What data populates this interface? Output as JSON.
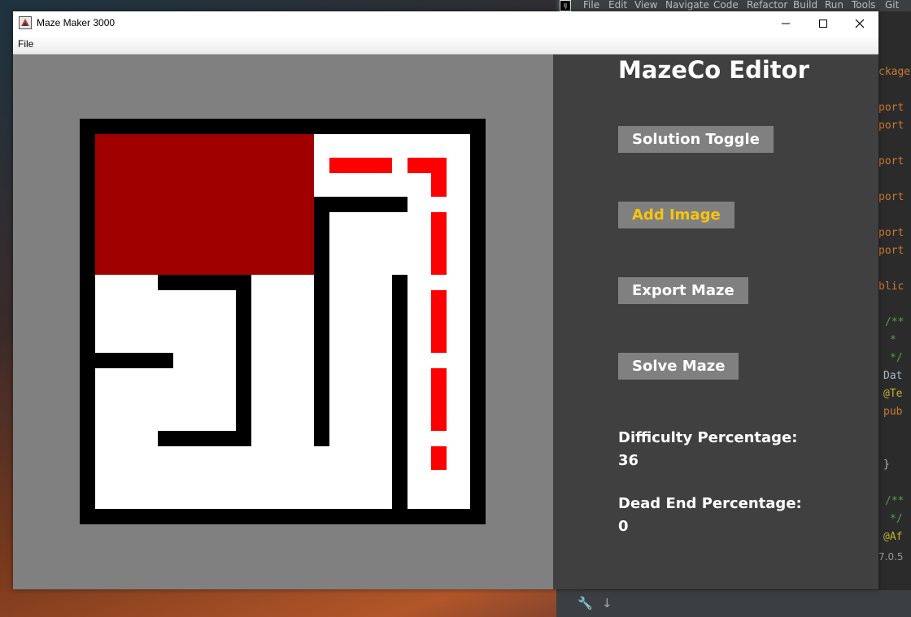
{
  "window": {
    "title": "Maze Maker 3000"
  },
  "menu": {
    "file": "File"
  },
  "panel": {
    "title": "MazeCo Editor",
    "buttons": {
      "solution_toggle": "Solution Toggle",
      "add_image": "Add Image",
      "export_maze": "Export Maze",
      "solve_maze": "Solve Maze"
    },
    "difficulty_label": "Difficulty Percentage:",
    "difficulty_value": "36",
    "dead_end_label": "Dead End Percentage:",
    "dead_end_value": "0"
  },
  "ide": {
    "menu": [
      "File",
      "Edit",
      "View",
      "Navigate",
      "Code",
      "Refactor",
      "Build",
      "Run",
      "Tools",
      "Git"
    ],
    "code_fragments": [
      "ckage",
      "port",
      "port",
      "port",
      "port",
      "port",
      "port",
      "blic",
      "/**",
      "*",
      "*/",
      "Dat",
      "@Te",
      "pub",
      "}",
      "/**",
      "*/",
      "@Af"
    ],
    "status": "7.0.5"
  },
  "colors": {
    "canvas": "#808080",
    "panel": "#404040",
    "button": "#808080",
    "highlight_text": "#f9c50c",
    "image_block": "#a00000",
    "solution_path": "#ff0000"
  }
}
